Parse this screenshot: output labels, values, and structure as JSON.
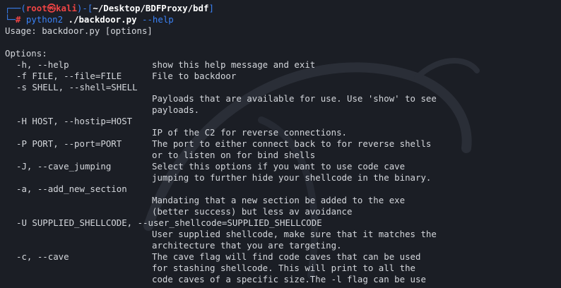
{
  "prompt": {
    "box_open": "┌──(",
    "user": "root",
    "at": "㉿",
    "host": "kali",
    "sep": ")-[",
    "path": "~/Desktop/BDFProxy/bdf",
    "close": "]",
    "corner": "└─",
    "hash": "#",
    "cmd": "python2",
    "arg1": "./backdoor.py",
    "arg2": "--help"
  },
  "output": {
    "usage": "Usage: backdoor.py [options]",
    "options_header": "Options:"
  },
  "options": [
    {
      "flag": "-h, --help",
      "desc": [
        "show this help message and exit"
      ]
    },
    {
      "flag": "-f FILE, --file=FILE",
      "desc": [
        "File to backdoor"
      ]
    },
    {
      "flag": "-s SHELL, --shell=SHELL",
      "desc": [],
      "desc_next": [
        "Payloads that are available for use. Use 'show' to see",
        "payloads."
      ]
    },
    {
      "flag": "-H HOST, --hostip=HOST",
      "desc": [],
      "desc_next": [
        "IP of the C2 for reverse connections."
      ]
    },
    {
      "flag": "-P PORT, --port=PORT",
      "desc": [
        "The port to either connect back to for reverse shells",
        "or to listen on for bind shells"
      ]
    },
    {
      "flag": "-J, --cave_jumping",
      "desc": [
        "Select this options if you want to use code cave",
        "jumping to further hide your shellcode in the binary."
      ]
    },
    {
      "flag": "-a, --add_new_section",
      "desc": [],
      "desc_next": [
        "Mandating that a new section be added to the exe",
        "(better success) but less av avoidance"
      ]
    },
    {
      "flag": "-U SUPPLIED_SHELLCODE, --user_shellcode=SUPPLIED_SHELLCODE",
      "desc": [],
      "desc_next": [
        "User supplied shellcode, make sure that it matches the",
        "architecture that you are targeting."
      ]
    },
    {
      "flag": "-c, --cave",
      "desc": [
        "The cave flag will find code caves that can be used",
        "for stashing shellcode. This will print to all the",
        "code caves of a specific size.The -l flag can be use"
      ]
    }
  ]
}
